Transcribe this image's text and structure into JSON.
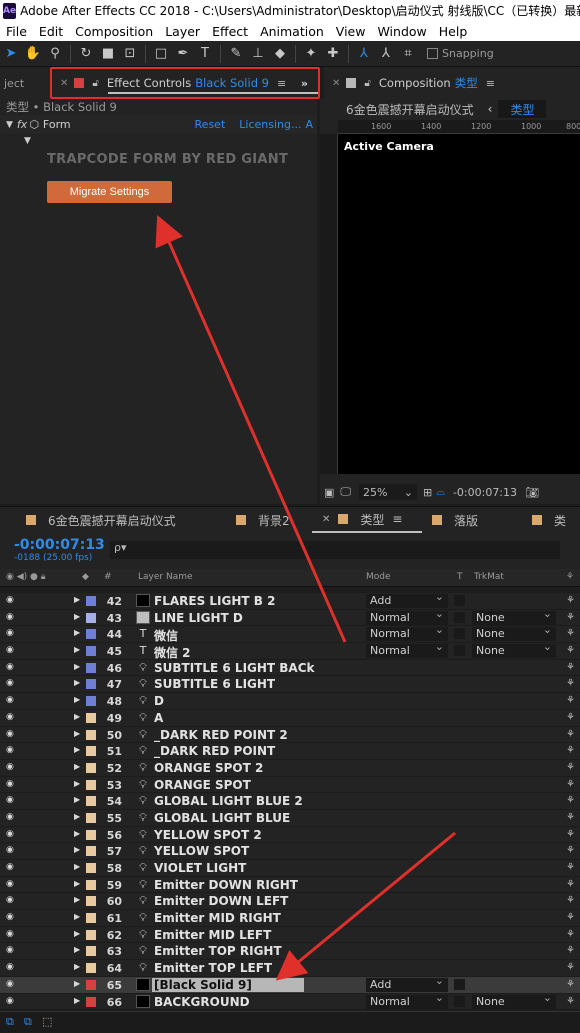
{
  "window": {
    "title": "Adobe After Effects CC 2018 - C:\\Users\\Administrator\\Desktop\\启动仪式 射线版\\CC（已转换）最新..."
  },
  "menu": [
    "File",
    "Edit",
    "Composition",
    "Layer",
    "Effect",
    "Animation",
    "View",
    "Window",
    "Help"
  ],
  "toolbar": {
    "snapping_label": "Snapping"
  },
  "project_tab": {
    "label": "ject"
  },
  "effect_tab": {
    "label": "Effect Controls",
    "layer": "Black Solid 9",
    "swatch": "#d64040"
  },
  "comp_tab": {
    "label": "Composition",
    "name": "类型"
  },
  "effect_panel": {
    "breadcrumb": "类型 • Black Solid 9",
    "effect_name": "Form",
    "reset": "Reset",
    "licensing": "Licensing...",
    "plugin_title": "TRAPCODE FORM BY RED GIANT",
    "migrate_button": "Migrate Settings"
  },
  "comp_panel": {
    "breadcrumb_left": "6金色震撼开幕启动仪式",
    "breadcrumb_right": "类型",
    "ruler_ticks": [
      "1600",
      "1400",
      "1200",
      "1000",
      "800"
    ],
    "camera_label": "Active Camera",
    "zoom": "25%",
    "timecode": "-0:00:07:13"
  },
  "timeline": {
    "tabs": [
      {
        "label": "6金色震撼开幕启动仪式",
        "color": "#d9a86c"
      },
      {
        "label": "背景2",
        "color": "#d9a86c"
      },
      {
        "label": "类型",
        "color": "#d9a86c",
        "active": true
      },
      {
        "label": "落版",
        "color": "#d9a86c"
      },
      {
        "label": "类",
        "color": "#d9a86c"
      }
    ],
    "timecode": "-0:00:07:13",
    "frame_info": "-0188 (25.00 fps)",
    "search_placeholder": "ρ▾",
    "columns": {
      "num": "#",
      "layer_name": "Layer Name",
      "mode": "Mode",
      "t": "T",
      "trkmat": "TrkMat"
    },
    "layers": [
      {
        "num": "42",
        "name": "FLARES LIGHT B 2",
        "type": "solid",
        "label": "#6f7fd6",
        "mode": "Add",
        "trk": ""
      },
      {
        "num": "43",
        "name": "LINE LIGHT D",
        "type": "solid-grey",
        "label": "#a7b0e6",
        "mode": "Normal",
        "trk": "None"
      },
      {
        "num": "44",
        "name": "微信",
        "type": "T",
        "label": "#6f7fd6",
        "mode": "Normal",
        "trk": "None"
      },
      {
        "num": "45",
        "name": "微信 2",
        "type": "T",
        "label": "#6f7fd6",
        "mode": "Normal",
        "trk": "None"
      },
      {
        "num": "46",
        "name": "SUBTITLE 6 LIGHT BACk",
        "type": "light",
        "label": "#6f7fd6",
        "mode": "",
        "trk": ""
      },
      {
        "num": "47",
        "name": "SUBTITLE 6 LIGHT",
        "type": "light",
        "label": "#6f7fd6",
        "mode": "",
        "trk": ""
      },
      {
        "num": "48",
        "name": "D",
        "type": "light",
        "label": "#6f7fd6",
        "mode": "",
        "trk": ""
      },
      {
        "num": "49",
        "name": "A",
        "type": "light",
        "label": "#e8c9a0",
        "mode": "",
        "trk": ""
      },
      {
        "num": "50",
        "name": "_DARK RED POINT 2",
        "type": "light",
        "label": "#e8c9a0",
        "mode": "",
        "trk": ""
      },
      {
        "num": "51",
        "name": "_DARK RED POINT",
        "type": "light",
        "label": "#e8c9a0",
        "mode": "",
        "trk": ""
      },
      {
        "num": "52",
        "name": "ORANGE SPOT 2",
        "type": "light",
        "label": "#e8c9a0",
        "mode": "",
        "trk": ""
      },
      {
        "num": "53",
        "name": "ORANGE SPOT",
        "type": "light",
        "label": "#e8c9a0",
        "mode": "",
        "trk": ""
      },
      {
        "num": "54",
        "name": "GLOBAL LIGHT BLUE 2",
        "type": "light",
        "label": "#e8c9a0",
        "mode": "",
        "trk": ""
      },
      {
        "num": "55",
        "name": "GLOBAL LIGHT BLUE",
        "type": "light",
        "label": "#e8c9a0",
        "mode": "",
        "trk": ""
      },
      {
        "num": "56",
        "name": "YELLOW SPOT 2",
        "type": "light",
        "label": "#e8c9a0",
        "mode": "",
        "trk": ""
      },
      {
        "num": "57",
        "name": "YELLOW SPOT",
        "type": "light",
        "label": "#e8c9a0",
        "mode": "",
        "trk": ""
      },
      {
        "num": "58",
        "name": "VIOLET LIGHT",
        "type": "light",
        "label": "#e8c9a0",
        "mode": "",
        "trk": ""
      },
      {
        "num": "59",
        "name": "Emitter DOWN RIGHT",
        "type": "light",
        "label": "#e8c9a0",
        "mode": "",
        "trk": ""
      },
      {
        "num": "60",
        "name": "Emitter DOWN LEFT",
        "type": "light",
        "label": "#e8c9a0",
        "mode": "",
        "trk": ""
      },
      {
        "num": "61",
        "name": "Emitter MID RIGHT",
        "type": "light",
        "label": "#e8c9a0",
        "mode": "",
        "trk": ""
      },
      {
        "num": "62",
        "name": "Emitter MID LEFT",
        "type": "light",
        "label": "#e8c9a0",
        "mode": "",
        "trk": ""
      },
      {
        "num": "63",
        "name": "Emitter TOP RIGHT",
        "type": "light",
        "label": "#e8c9a0",
        "mode": "",
        "trk": ""
      },
      {
        "num": "64",
        "name": "Emitter TOP LEFT",
        "type": "light",
        "label": "#e8c9a0",
        "mode": "",
        "trk": ""
      },
      {
        "num": "65",
        "name": "[Black Solid 9]",
        "type": "solid",
        "label": "#d64040",
        "mode": "Add",
        "trk": "",
        "selected": true
      },
      {
        "num": "66",
        "name": "BACKGROUND",
        "type": "solid",
        "label": "#d64040",
        "mode": "Normal",
        "trk": "None"
      }
    ]
  },
  "colors": {
    "accent_blue": "#2d8ceb",
    "annotation_red": "#e0302c",
    "migrate_orange": "#d06a3a"
  }
}
